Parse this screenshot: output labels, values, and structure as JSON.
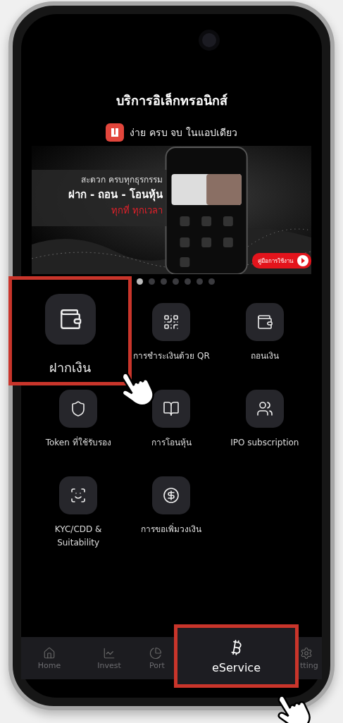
{
  "screen": {
    "title": "บริการอิเล็กทรอนิกส์"
  },
  "banner": {
    "tagline": "ง่าย ครบ จบ ในแอปเดียว",
    "headline": "สะดวก ครบทุกธุรกรรม",
    "subheadline": "ฝาก - ถอน - โอนหุ้น",
    "slogan": "ทุกที่ ทุกเวลา",
    "guide_button": "คู่มือการใช้งาน"
  },
  "carousel_dots": [
    {
      "selected": true
    },
    {
      "selected": false
    },
    {
      "selected": false
    },
    {
      "selected": false
    },
    {
      "selected": false
    },
    {
      "selected": false
    },
    {
      "selected": false
    }
  ],
  "services": [
    {
      "label": "ฝากเงิน",
      "kind": "deposit",
      "highlighted": true
    },
    {
      "label": "การชำระเงินด้วย QR",
      "kind": "qr",
      "highlighted": false
    },
    {
      "label": "ถอนเงิน",
      "kind": "withdraw",
      "highlighted": false
    },
    {
      "label": "Token ที่ใช้รับรอง",
      "kind": "token",
      "highlighted": false
    },
    {
      "label": "การโอนหุ้น",
      "kind": "transfer",
      "highlighted": false
    },
    {
      "label": "IPO subscription",
      "kind": "ipo",
      "highlighted": false
    },
    {
      "label": "KYC/CDD & Suitability",
      "kind": "kyc",
      "highlighted": false
    },
    {
      "label": "การขอเพิ่มวงเงิน",
      "kind": "credit",
      "highlighted": false
    }
  ],
  "nav": [
    {
      "label": "Home",
      "kind": "home",
      "highlighted": false
    },
    {
      "label": "Invest",
      "kind": "invest",
      "highlighted": false
    },
    {
      "label": "Port",
      "kind": "portfolio",
      "highlighted": false
    },
    {
      "label": "eService",
      "kind": "eservice",
      "highlighted": true
    },
    {
      "label": "tting",
      "kind": "settings",
      "highlighted": false
    }
  ]
}
